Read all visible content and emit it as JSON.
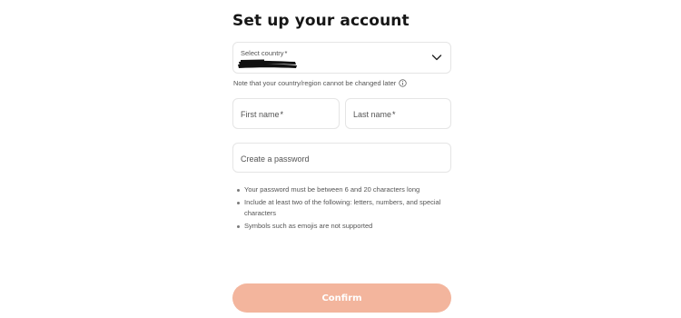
{
  "page": {
    "title": "Set up your account"
  },
  "country": {
    "label": "Select country",
    "required_mark": "*",
    "value_redacted": true,
    "dropdown_icon": "chevron-down-icon"
  },
  "note": {
    "text": "Note that your country/region cannot be changed later",
    "icon": "info-icon"
  },
  "name_fields": {
    "first_label": "First name",
    "last_label": "Last name",
    "required_mark": "*"
  },
  "password": {
    "placeholder": "Create a password"
  },
  "password_rules": [
    "Your password must be between 6 and 20 characters long",
    "Include at least two of the following: letters, numbers, and special characters",
    "Symbols such as emojis are not supported"
  ],
  "actions": {
    "confirm_label": "Confirm"
  },
  "colors": {
    "confirm_button": "#f3b59d",
    "field_border": "#e5e5e5",
    "redaction": "#111111"
  }
}
